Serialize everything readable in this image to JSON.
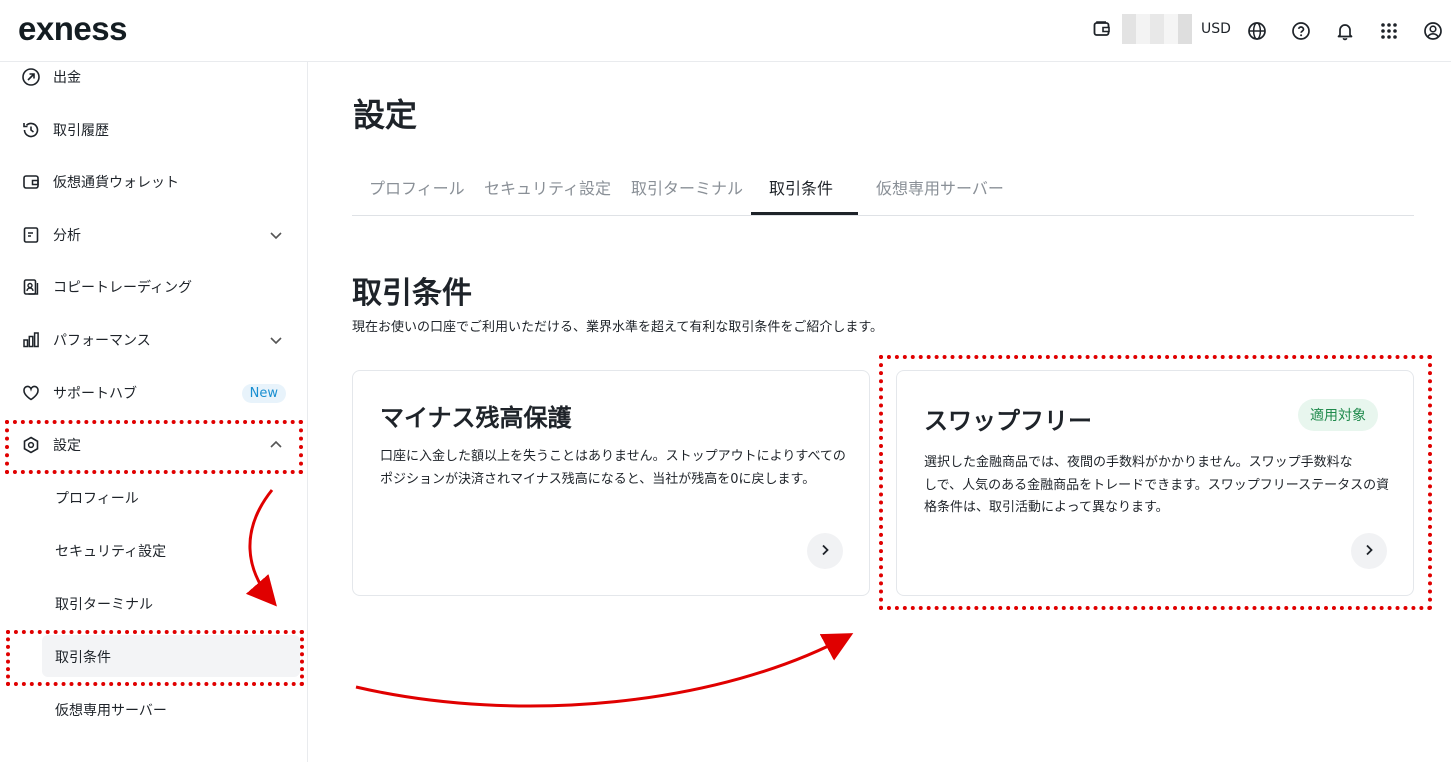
{
  "header": {
    "logo": "exness",
    "currency": "USD",
    "icons": [
      "wallet-icon",
      "globe-icon",
      "help-icon",
      "bell-icon",
      "apps-grid-icon",
      "account-icon"
    ]
  },
  "sidebar": {
    "items": [
      {
        "label": "出金",
        "icon": "withdraw-icon"
      },
      {
        "label": "取引履歴",
        "icon": "history-icon"
      },
      {
        "label": "仮想通貨ウォレット",
        "icon": "crypto-wallet-icon"
      },
      {
        "label": "分析",
        "icon": "analytics-icon"
      },
      {
        "label": "コピートレーディング",
        "icon": "copy-trading-icon"
      },
      {
        "label": "パフォーマンス",
        "icon": "performance-icon"
      },
      {
        "label": "サポートハブ",
        "icon": "heart-icon",
        "badge": "New"
      },
      {
        "label": "設定",
        "icon": "settings-icon"
      }
    ],
    "settings_sub": [
      "プロフィール",
      "セキュリティ設定",
      "取引ターミナル",
      "取引条件",
      "仮想専用サーバー"
    ]
  },
  "main": {
    "title": "設定",
    "tabs": [
      "プロフィール",
      "セキュリティ設定",
      "取引ターミナル",
      "取引条件",
      "仮想専用サーバー"
    ],
    "active_tab": "取引条件",
    "section_title": "取引条件",
    "section_desc": "現在お使いの口座でご利用いただける、業界水準を超えて有利な取引条件をご紹介します。",
    "cards": [
      {
        "title": "マイナス残高保護",
        "line1": "口座に入金した額以上を失うことはありません。ストップアウトによりすべての",
        "line2": "ポジションが決済されマイナス残高になると、当社が残高を0に戻します。"
      },
      {
        "title": "スワップフリー",
        "badge": "適用対象",
        "line1": "選択した金融商品では、夜間の手数料がかかりません。スワップ手数料な",
        "line2": "しで、人気のある金融商品をトレードできます。スワップフリーステータスの資",
        "line3": "格条件は、取引活動によって異なります。"
      }
    ]
  },
  "colors": {
    "annotation": "#e00000",
    "eligible_text": "#1f8a4c",
    "new_badge": "#1a8fd1"
  }
}
